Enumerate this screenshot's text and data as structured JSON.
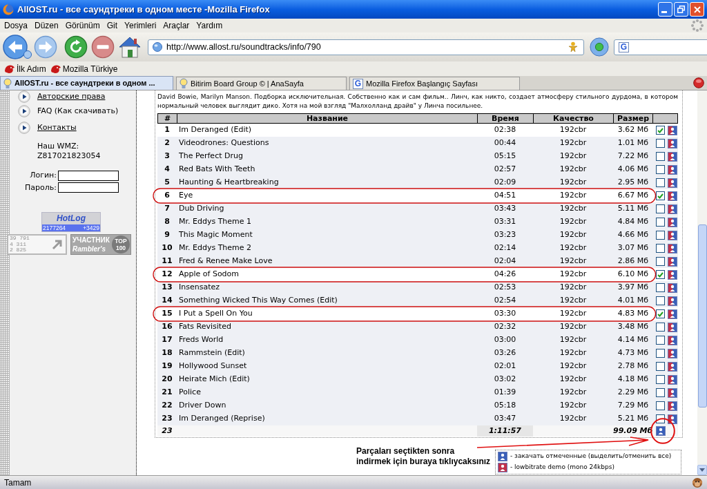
{
  "window": {
    "title": "AllOST.ru - все саундтреки в одном месте -Mozilla Firefox"
  },
  "menu": [
    "Dosya",
    "Düzen",
    "Görünüm",
    "Git",
    "Yerimleri",
    "Araçlar",
    "Yardım"
  ],
  "address_bar": {
    "url": "http://www.allost.ru/soundtracks/info/790"
  },
  "search_box": {
    "engine_letter": "G"
  },
  "bookmarks": [
    "İlk Adım",
    "Mozilla Türkiye"
  ],
  "tabs": [
    {
      "label": "AllOST.ru - все саундтреки в одном ...",
      "selected": true,
      "kind": "bulb"
    },
    {
      "label": "Bitirim Board Group © | AnaSayfa",
      "selected": false,
      "kind": "bulb"
    },
    {
      "label": "Mozilla Firefox Başlangıç Sayfası",
      "selected": false,
      "kind": "letter",
      "icon_letter": "G"
    }
  ],
  "sidebar": {
    "links": [
      {
        "label": "Авторские права",
        "underlined": true
      },
      {
        "label": "FAQ (Как скачивать)",
        "underlined": false
      },
      {
        "label": "Контакты",
        "underlined": true
      }
    ],
    "wmz_label": "Наш WMZ:",
    "wmz": "Z817021823054",
    "login_label": "Логин:",
    "password_label": "Пароль:"
  },
  "badges": {
    "hotlog": {
      "logo": "HotLog",
      "total": "2177264",
      "today": "+3429"
    },
    "stats": [
      "39 791",
      "4 311",
      "2 825"
    ],
    "rambler": {
      "label": "УЧАСТНИК",
      "brand": "Rambler's",
      "top": "TOP",
      "rank": "100"
    }
  },
  "description": "David Bowie, Marilyn Manson. Подборка исключительная. Собственно как и сам фильм.. Линч, как никто, создает атмосферу стильного дурдома, в котором нормальный человек выглядит дико. Хотя на мой взгляд \"Малхолланд драйв\" у Линча посильнее.",
  "table": {
    "columns": [
      "#",
      "Название",
      "Время",
      "Качество",
      "Размер"
    ],
    "rows": [
      {
        "num": "1",
        "title": "Im Deranged (Edit)",
        "time": "02:38",
        "quality": "192cbr",
        "size": "3.62 Мб",
        "checked": true,
        "circled": false
      },
      {
        "num": "2",
        "title": "Videodrones: Questions",
        "time": "00:44",
        "quality": "192cbr",
        "size": "1.01 Мб",
        "checked": false,
        "circled": false
      },
      {
        "num": "3",
        "title": "The Perfect Drug",
        "time": "05:15",
        "quality": "192cbr",
        "size": "7.22 Мб",
        "checked": false,
        "circled": false
      },
      {
        "num": "4",
        "title": "Red Bats With Teeth",
        "time": "02:57",
        "quality": "192cbr",
        "size": "4.06 Мб",
        "checked": false,
        "circled": false
      },
      {
        "num": "5",
        "title": "Haunting & Heartbreaking",
        "time": "02:09",
        "quality": "192cbr",
        "size": "2.95 Мб",
        "checked": false,
        "circled": false
      },
      {
        "num": "6",
        "title": "Eye",
        "time": "04:51",
        "quality": "192cbr",
        "size": "6.67 Мб",
        "checked": true,
        "circled": true
      },
      {
        "num": "7",
        "title": "Dub Driving",
        "time": "03:43",
        "quality": "192cbr",
        "size": "5.11 Мб",
        "checked": false,
        "circled": false
      },
      {
        "num": "8",
        "title": "Mr. Eddys Theme 1",
        "time": "03:31",
        "quality": "192cbr",
        "size": "4.84 Мб",
        "checked": false,
        "circled": false
      },
      {
        "num": "9",
        "title": "This Magic Moment",
        "time": "03:23",
        "quality": "192cbr",
        "size": "4.66 Мб",
        "checked": false,
        "circled": false
      },
      {
        "num": "10",
        "title": "Mr. Eddys Theme 2",
        "time": "02:14",
        "quality": "192cbr",
        "size": "3.07 Мб",
        "checked": false,
        "circled": false
      },
      {
        "num": "11",
        "title": "Fred & Renee Make Love",
        "time": "02:04",
        "quality": "192cbr",
        "size": "2.86 Мб",
        "checked": false,
        "circled": false
      },
      {
        "num": "12",
        "title": "Apple of Sodom",
        "time": "04:26",
        "quality": "192cbr",
        "size": "6.10 Мб",
        "checked": true,
        "circled": true
      },
      {
        "num": "13",
        "title": "Insensatez",
        "time": "02:53",
        "quality": "192cbr",
        "size": "3.97 Мб",
        "checked": false,
        "circled": false
      },
      {
        "num": "14",
        "title": "Something Wicked This Way Comes (Edit)",
        "time": "02:54",
        "quality": "192cbr",
        "size": "4.01 Мб",
        "checked": false,
        "circled": false
      },
      {
        "num": "15",
        "title": "I Put a Spell On You",
        "time": "03:30",
        "quality": "192cbr",
        "size": "4.83 Мб",
        "checked": true,
        "circled": true
      },
      {
        "num": "16",
        "title": "Fats Revisited",
        "time": "02:32",
        "quality": "192cbr",
        "size": "3.48 Мб",
        "checked": false,
        "circled": false
      },
      {
        "num": "17",
        "title": "Freds World",
        "time": "03:00",
        "quality": "192cbr",
        "size": "4.14 Мб",
        "checked": false,
        "circled": false
      },
      {
        "num": "18",
        "title": "Rammstein (Edit)",
        "time": "03:26",
        "quality": "192cbr",
        "size": "4.73 Мб",
        "checked": false,
        "circled": false
      },
      {
        "num": "19",
        "title": "Hollywood Sunset",
        "time": "02:01",
        "quality": "192cbr",
        "size": "2.78 Мб",
        "checked": false,
        "circled": false
      },
      {
        "num": "20",
        "title": "Heirate Mich (Edit)",
        "time": "03:02",
        "quality": "192cbr",
        "size": "4.18 Мб",
        "checked": false,
        "circled": false
      },
      {
        "num": "21",
        "title": "Police",
        "time": "01:39",
        "quality": "192cbr",
        "size": "2.29 Мб",
        "checked": false,
        "circled": false
      },
      {
        "num": "22",
        "title": "Driver Down",
        "time": "05:18",
        "quality": "192cbr",
        "size": "7.29 Мб",
        "checked": false,
        "circled": false
      },
      {
        "num": "23",
        "title": "Im Deranged (Reprise)",
        "time": "03:47",
        "quality": "192cbr",
        "size": "5.21 Мб",
        "checked": false,
        "circled": false
      }
    ],
    "footer": {
      "count": "23",
      "total_time": "1:11:57",
      "total_size": "99.09 Мб",
      "circled": true
    }
  },
  "annotation": {
    "text": "Parçaları seçtikten sonra\nindirmek için buraya tıklıycaksınız"
  },
  "legend": [
    {
      "kind": "download",
      "text": "- закачать отмеченные (выделить/отменить все)"
    },
    {
      "kind": "demo",
      "text": "- lowbitrate demo (mono 24kbps)"
    }
  ],
  "status_bar": {
    "text": "Tamam"
  }
}
